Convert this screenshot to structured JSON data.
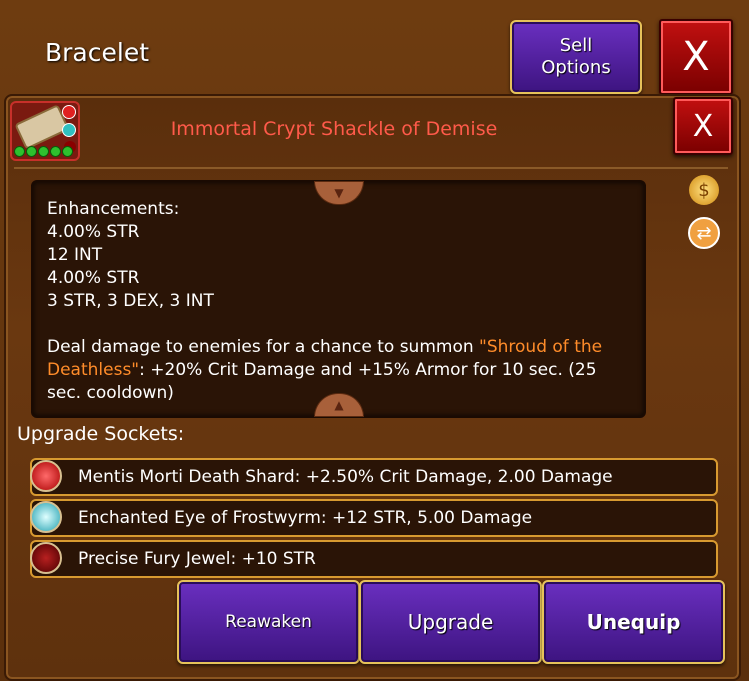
{
  "window": {
    "title": "Bracelet",
    "sell_label_line1": "Sell",
    "sell_label_line2": "Options",
    "close_label": "X"
  },
  "item": {
    "name": "Immortal Crypt Shackle of Demise",
    "name_color": "#ff5a4a",
    "close_label": "X"
  },
  "description": {
    "enhancements_title": "Enhancements:",
    "enhancements": [
      "4.00% STR",
      "12 INT",
      "4.00% STR",
      "3 STR, 3 DEX, 3 INT"
    ],
    "effect_prefix": "Deal damage to enemies for a chance to summon ",
    "effect_highlight": "\"Shroud of the Deathless\"",
    "effect_suffix": ": +20% Crit Damage and +15% Armor for 10 sec. (25 sec. cooldown)",
    "highlight_color": "#ff8c2a"
  },
  "side_icons": [
    "gold-bag-icon",
    "swap-icon"
  ],
  "sockets": {
    "title": "Upgrade Sockets:",
    "items": [
      {
        "text": "Mentis Morti Death Shard: +2.50% Crit Damage, 2.00 Damage",
        "icon": "red-gem-icon"
      },
      {
        "text": "Enchanted Eye of Frostwyrm: +12 STR, 5.00 Damage",
        "icon": "cyan-gem-icon"
      },
      {
        "text": "Precise Fury Jewel: +10 STR",
        "icon": "dark-red-gem-icon"
      }
    ]
  },
  "actions": {
    "reawaken": "Reawaken",
    "upgrade": "Upgrade",
    "unequip": "Unequip"
  },
  "colors": {
    "background": "#5a2f0c",
    "button_purple": "#5a22a8",
    "button_red": "#c21010",
    "border_gold": "#e6c25a"
  }
}
